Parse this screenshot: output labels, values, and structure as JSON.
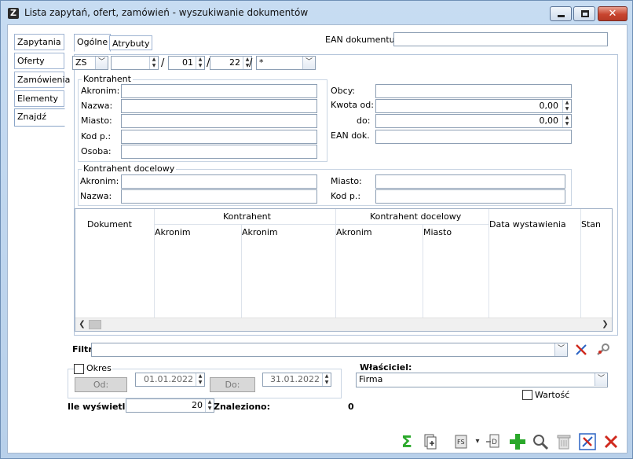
{
  "window": {
    "app_icon": "Z",
    "title": "Lista zapytań, ofert, zamówień - wyszukiwanie dokumentów",
    "icons": [
      "minimize-icon",
      "maximize-icon",
      "close-icon"
    ]
  },
  "side_tabs": [
    "Zapytania",
    "Oferty",
    "Zamówienia",
    "Elementy",
    "Znajdź"
  ],
  "top_tabs": [
    "Ogólne",
    "Atrybuty"
  ],
  "ean_dokumentu": {
    "label": "EAN dokumentu:",
    "value": ""
  },
  "document_number": {
    "type": "ZS",
    "number": "",
    "month": "01",
    "year": "22",
    "series": "*"
  },
  "kontrahent": {
    "title": "Kontrahent",
    "akronim_label": "Akronim:",
    "nazwa_label": "Nazwa:",
    "miasto_label": "Miasto:",
    "kod_label": "Kod p.:",
    "osoba_label": "Osoba:"
  },
  "right_fields": {
    "obcy_label": "Obcy:",
    "kwota_od_label": "Kwota od:",
    "kwota_od_value": "0,00",
    "do_label": "do:",
    "do_value": "0,00",
    "ean_dok_label": "EAN dok."
  },
  "kontrahent_docelowy": {
    "title": "Kontrahent docelowy",
    "akronim_label": "Akronim:",
    "nazwa_label": "Nazwa:",
    "miasto_label": "Miasto:",
    "kod_label": "Kod p.:"
  },
  "grid": {
    "col_dokument": "Dokument",
    "group_kontrahent": "Kontrahent",
    "group_docelowy": "Kontrahent docelowy",
    "sub_akronim_1": "Akronim",
    "sub_akronim_2": "Akronim",
    "sub_akronim_3": "Akronim",
    "sub_miasto": "Miasto",
    "col_data": "Data wystawienia",
    "col_stan": "Stan",
    "rows": []
  },
  "filtr": {
    "label": "Filtr:",
    "value": ""
  },
  "okres": {
    "label": "Okres",
    "checked": false,
    "od_button": "Od:",
    "od_value": "01.01.2022",
    "do_button": "Do:",
    "do_value": "31.01.2022"
  },
  "wlasciciel": {
    "label": "Właściciel:",
    "value": "Firma"
  },
  "wartosc": {
    "label": "Wartość",
    "checked": false
  },
  "ile": {
    "label": "Ile wyświetlać:",
    "value": "20"
  },
  "znaleziono": {
    "label": "Znaleziono:",
    "value": "0"
  },
  "toolbar_icons": [
    "sum-icon",
    "export-document-icon",
    "fs-icon",
    "dropdown-icon",
    "document-icon",
    "add-icon",
    "search-icon",
    "delete-icon",
    "confirm-icon",
    "cancel-icon"
  ],
  "colors": {
    "window_frame": "#c7dcf2",
    "add_green": "#2aa82a",
    "cancel_red": "#d02a1e",
    "confirm_blue": "#2b63c4"
  }
}
